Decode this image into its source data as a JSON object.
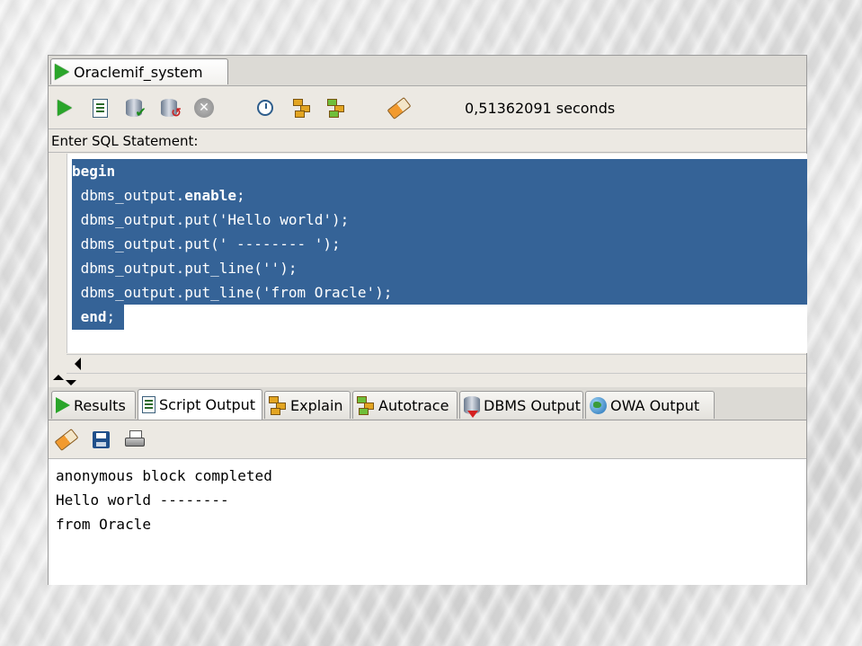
{
  "session_tab": {
    "label": "Oraclemif_system"
  },
  "toolbar": {
    "elapsed": "0,51362091 seconds",
    "icons": [
      "run-statement-icon",
      "run-script-icon",
      "commit-icon",
      "rollback-icon",
      "cancel-icon",
      "sql-history-icon",
      "explain-plan-icon",
      "autotrace-icon",
      "clear-icon"
    ]
  },
  "editor": {
    "label": "Enter SQL Statement:",
    "lines": [
      {
        "keyword": "begin",
        "rest": ""
      },
      {
        "keyword": "",
        "rest": " dbms_output.",
        "kw2": "enable",
        "tail": ";"
      },
      {
        "keyword": "",
        "rest": " dbms_output.put('Hello world');"
      },
      {
        "keyword": "",
        "rest": " dbms_output.put(' -------- ');"
      },
      {
        "keyword": "",
        "rest": " dbms_output.put_line('');"
      },
      {
        "keyword": "",
        "rest": " dbms_output.put_line('from Oracle');"
      },
      {
        "keyword": " end",
        "rest": ";"
      }
    ]
  },
  "output_tabs": [
    {
      "label": "Results",
      "icon": "run-icon",
      "active": false
    },
    {
      "label": "Script Output",
      "icon": "script-icon",
      "active": true
    },
    {
      "label": "Explain",
      "icon": "explain-icon",
      "active": false
    },
    {
      "label": "Autotrace",
      "icon": "autotrace-icon",
      "active": false
    },
    {
      "label": "DBMS Output",
      "icon": "dbms-output-icon",
      "active": false
    },
    {
      "label": "OWA Output",
      "icon": "globe-icon",
      "active": false
    }
  ],
  "output_toolbar": {
    "icons": [
      "clear-icon",
      "save-icon",
      "print-icon"
    ]
  },
  "output": {
    "lines": [
      "anonymous block completed",
      "Hello world --------",
      "from Oracle"
    ]
  }
}
